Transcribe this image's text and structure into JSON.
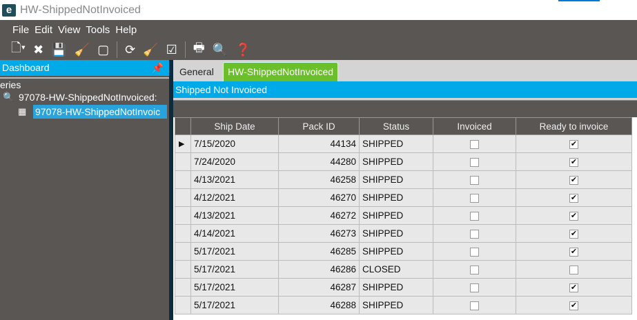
{
  "window": {
    "title": "HW-ShippedNotInvoiced",
    "logo": "e"
  },
  "menu": [
    "File",
    "Edit",
    "View",
    "Tools",
    "Help"
  ],
  "left_panel": {
    "title": "Dashboard",
    "section": "eries",
    "query": "97078-HW-ShippedNotInvoiced:",
    "grid": "97078-HW-ShippedNotInvoic"
  },
  "tabs": [
    "General",
    "HW-ShippedNotInvoiced"
  ],
  "grid_title": "Shipped Not Invoiced",
  "columns": [
    "Ship Date",
    "Pack ID",
    "Status",
    "Invoiced",
    "Ready to invoice"
  ],
  "rows": [
    {
      "date": "7/15/2020",
      "pack": "44134",
      "status": "SHIPPED",
      "invoiced": false,
      "ready": true
    },
    {
      "date": "7/24/2020",
      "pack": "44280",
      "status": "SHIPPED",
      "invoiced": false,
      "ready": true
    },
    {
      "date": "4/13/2021",
      "pack": "46258",
      "status": "SHIPPED",
      "invoiced": false,
      "ready": true
    },
    {
      "date": "4/12/2021",
      "pack": "46270",
      "status": "SHIPPED",
      "invoiced": false,
      "ready": true
    },
    {
      "date": "4/13/2021",
      "pack": "46272",
      "status": "SHIPPED",
      "invoiced": false,
      "ready": true
    },
    {
      "date": "4/14/2021",
      "pack": "46273",
      "status": "SHIPPED",
      "invoiced": false,
      "ready": true
    },
    {
      "date": "5/17/2021",
      "pack": "46285",
      "status": "SHIPPED",
      "invoiced": false,
      "ready": true
    },
    {
      "date": "5/17/2021",
      "pack": "46286",
      "status": "CLOSED",
      "invoiced": false,
      "ready": false
    },
    {
      "date": "5/17/2021",
      "pack": "46287",
      "status": "SHIPPED",
      "invoiced": false,
      "ready": true
    },
    {
      "date": "5/17/2021",
      "pack": "46288",
      "status": "SHIPPED",
      "invoiced": false,
      "ready": true
    }
  ]
}
